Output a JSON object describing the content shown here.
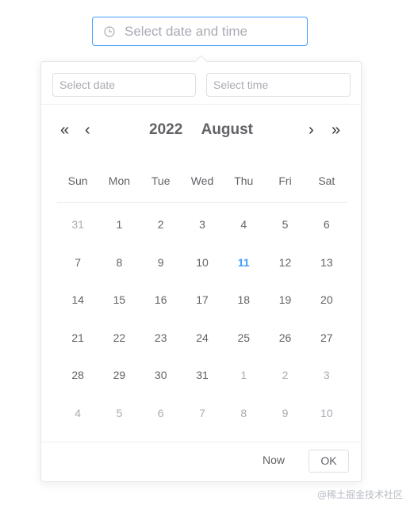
{
  "main_input": {
    "placeholder": "Select date and time",
    "icon": "clock-icon"
  },
  "panel": {
    "date_placeholder": "Select date",
    "time_placeholder": "Select time",
    "nav": {
      "prev_year": "«",
      "prev_month": "‹",
      "next_month": "›",
      "next_year": "»"
    },
    "year": "2022",
    "month": "August",
    "weekdays": [
      "Sun",
      "Mon",
      "Tue",
      "Wed",
      "Thu",
      "Fri",
      "Sat"
    ],
    "weeks": [
      [
        {
          "d": "31",
          "m": true
        },
        {
          "d": "1"
        },
        {
          "d": "2"
        },
        {
          "d": "3"
        },
        {
          "d": "4"
        },
        {
          "d": "5"
        },
        {
          "d": "6"
        }
      ],
      [
        {
          "d": "7"
        },
        {
          "d": "8"
        },
        {
          "d": "9"
        },
        {
          "d": "10"
        },
        {
          "d": "11",
          "today": true
        },
        {
          "d": "12"
        },
        {
          "d": "13"
        }
      ],
      [
        {
          "d": "14"
        },
        {
          "d": "15"
        },
        {
          "d": "16"
        },
        {
          "d": "17"
        },
        {
          "d": "18"
        },
        {
          "d": "19"
        },
        {
          "d": "20"
        }
      ],
      [
        {
          "d": "21"
        },
        {
          "d": "22"
        },
        {
          "d": "23"
        },
        {
          "d": "24"
        },
        {
          "d": "25"
        },
        {
          "d": "26"
        },
        {
          "d": "27"
        }
      ],
      [
        {
          "d": "28"
        },
        {
          "d": "29"
        },
        {
          "d": "30"
        },
        {
          "d": "31"
        },
        {
          "d": "1",
          "m": true
        },
        {
          "d": "2",
          "m": true
        },
        {
          "d": "3",
          "m": true
        }
      ],
      [
        {
          "d": "4",
          "m": true
        },
        {
          "d": "5",
          "m": true
        },
        {
          "d": "6",
          "m": true
        },
        {
          "d": "7",
          "m": true
        },
        {
          "d": "8",
          "m": true
        },
        {
          "d": "9",
          "m": true
        },
        {
          "d": "10",
          "m": true
        }
      ]
    ],
    "footer": {
      "now_label": "Now",
      "ok_label": "OK"
    }
  },
  "watermark": "@稀土掘金技术社区",
  "colors": {
    "accent": "#409eff",
    "muted": "#a8abb2",
    "text": "#606266"
  }
}
